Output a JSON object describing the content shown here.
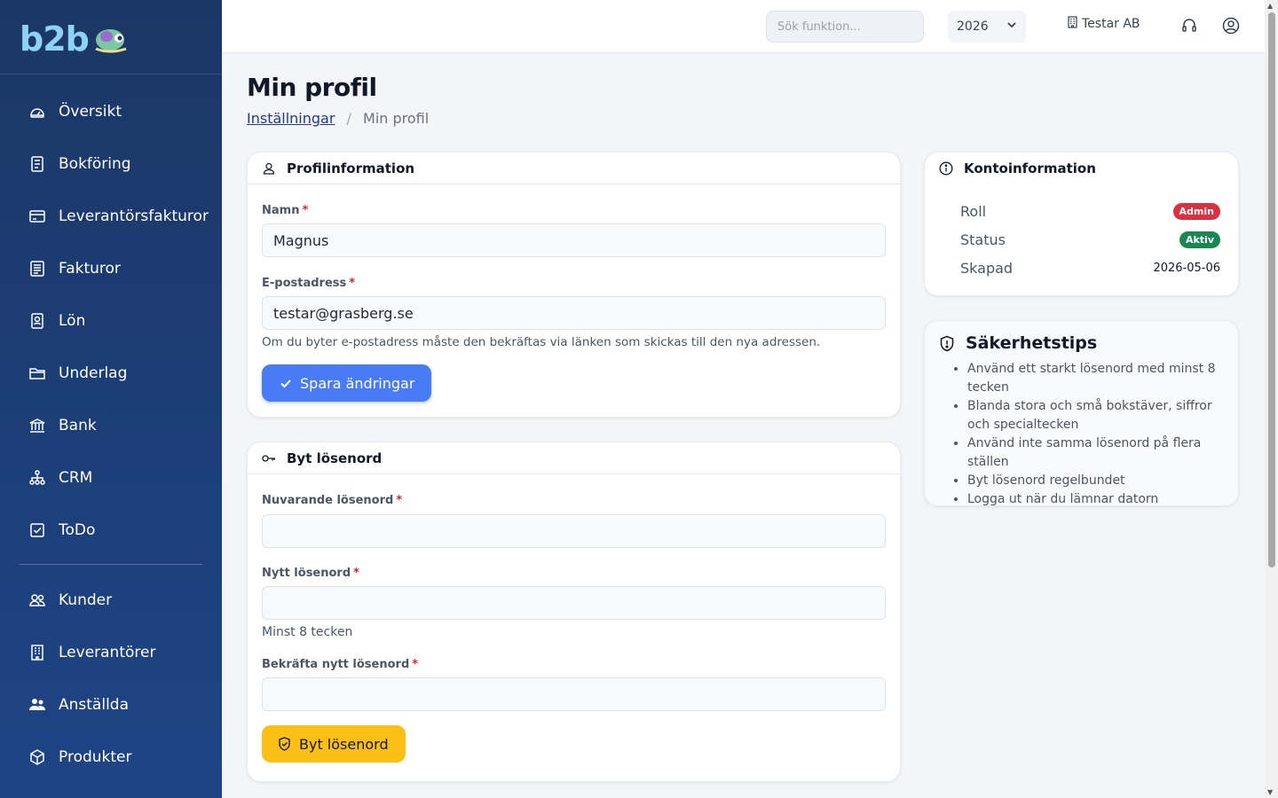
{
  "sidebar": {
    "logo_part1": "b2b",
    "items": [
      {
        "label": "Översikt",
        "icon": "dashboard-icon"
      },
      {
        "label": "Bokföring",
        "icon": "ledger-icon"
      },
      {
        "label": "Leverantörsfakturor",
        "icon": "credit-card-icon"
      },
      {
        "label": "Fakturor",
        "icon": "invoice-icon"
      },
      {
        "label": "Lön",
        "icon": "badge-icon"
      },
      {
        "label": "Underlag",
        "icon": "folder-icon"
      },
      {
        "label": "Bank",
        "icon": "bank-icon"
      },
      {
        "label": "CRM",
        "icon": "network-icon"
      },
      {
        "label": "ToDo",
        "icon": "checkbox-icon"
      }
    ],
    "items2": [
      {
        "label": "Kunder",
        "icon": "users-icon"
      },
      {
        "label": "Leverantörer",
        "icon": "building-icon"
      },
      {
        "label": "Anställda",
        "icon": "people-icon"
      },
      {
        "label": "Produkter",
        "icon": "box-icon"
      }
    ]
  },
  "topbar": {
    "search_placeholder": "Sök funktion...",
    "year": "2026",
    "company": "Testar AB"
  },
  "page": {
    "title": "Min profil",
    "breadcrumb_parent": "Inställningar",
    "breadcrumb_current": "Min profil"
  },
  "profile": {
    "header": "Profilinformation",
    "name_label": "Namn",
    "name_value": "Magnus",
    "email_label": "E-postadress",
    "email_value": "testar@grasberg.se",
    "email_help": "Om du byter e-postadress måste den bekräftas via länken som skickas till den nya adressen.",
    "save_label": "Spara ändringar"
  },
  "password": {
    "header": "Byt lösenord",
    "current_label": "Nuvarande lösenord",
    "new_label": "Nytt lösenord",
    "new_help": "Minst 8 tecken",
    "confirm_label": "Bekräfta nytt lösenord",
    "submit_label": "Byt lösenord"
  },
  "account": {
    "header": "Kontoinformation",
    "role_key": "Roll",
    "role_value": "Admin",
    "status_key": "Status",
    "status_value": "Aktiv",
    "created_key": "Skapad",
    "created_value": "2026-05-06"
  },
  "tips": {
    "title": "Säkerhetstips",
    "items": [
      "Använd ett starkt lösenord med minst 8 tecken",
      "Blanda stora och små bokstäver, siffror och specialtecken",
      "Använd inte samma lösenord på flera ställen",
      "Byt lösenord regelbundet",
      "Logga ut när du lämnar datorn"
    ]
  },
  "colors": {
    "sidebar": "#1e4486",
    "primary": "#4a7bf7",
    "warning": "#fbbf16",
    "admin_badge": "#dc2f3f",
    "active_badge": "#198754"
  }
}
